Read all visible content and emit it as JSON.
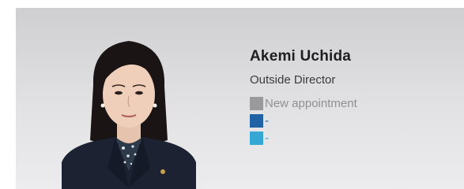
{
  "profile": {
    "name": "Akemi Uchida",
    "role": "Outside Director"
  },
  "legend": [
    {
      "label": "New appointment",
      "color": "#9a9a9c",
      "text_color": "#8f8f92"
    },
    {
      "label": "-",
      "color": "#1f63a6",
      "text_color": "#1f63a6"
    },
    {
      "label": "-",
      "color": "#34a7d4",
      "text_color": "#34a7d4"
    }
  ]
}
